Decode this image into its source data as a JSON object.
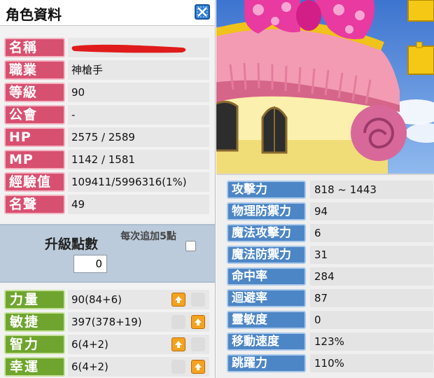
{
  "window": {
    "title": "角色資料"
  },
  "profile": {
    "rows": [
      {
        "label": "名稱",
        "value": ""
      },
      {
        "label": "職業",
        "value": "神槍手"
      },
      {
        "label": "等級",
        "value": "90"
      },
      {
        "label": "公會",
        "value": "-"
      },
      {
        "label": "HP",
        "value": "2575 / 2589"
      },
      {
        "label": "MP",
        "value": "1142 / 1581"
      },
      {
        "label": "經驗值",
        "value": "109411/5996316(1%)"
      },
      {
        "label": "名聲",
        "value": "49"
      }
    ]
  },
  "upgrade": {
    "label": "升級點數",
    "points": "0",
    "per_click_label": "每次追加5點"
  },
  "stats": [
    {
      "label": "力量",
      "value": "90(84+6)"
    },
    {
      "label": "敏捷",
      "value": "397(378+19)"
    },
    {
      "label": "智力",
      "value": "6(4+2)"
    },
    {
      "label": "幸運",
      "value": "6(4+2)"
    }
  ],
  "combat": [
    {
      "label": "攻擊力",
      "value": "818 ~ 1443"
    },
    {
      "label": "物理防禦力",
      "value": "94"
    },
    {
      "label": "魔法攻擊力",
      "value": "6"
    },
    {
      "label": "魔法防禦力",
      "value": "31"
    },
    {
      "label": "命中率",
      "value": "284"
    },
    {
      "label": "迴避率",
      "value": "87"
    },
    {
      "label": "靈敏度",
      "value": "0"
    },
    {
      "label": "移動速度",
      "value": "123%"
    },
    {
      "label": "跳躍力",
      "value": "110%"
    }
  ],
  "colors": {
    "profile_label": "#d85070",
    "stat_label": "#6fa52e",
    "combat_label": "#4d86c6",
    "redaction": "#e01b1b"
  }
}
